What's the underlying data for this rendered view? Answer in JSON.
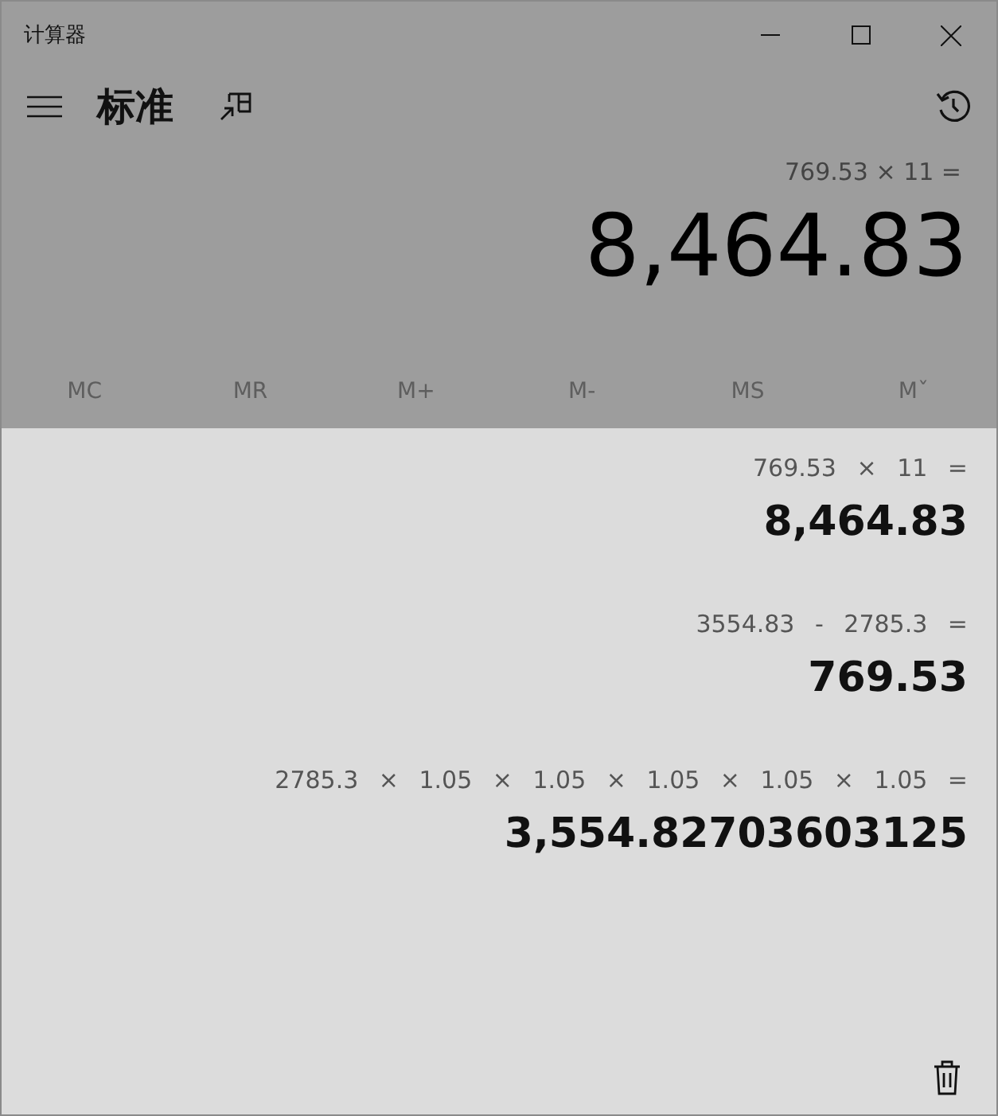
{
  "window": {
    "title": "计算器"
  },
  "header": {
    "mode": "标准"
  },
  "display": {
    "expression": "769.53 × 11 =",
    "result": "8,464.83"
  },
  "memory_buttons": [
    {
      "label": "MC",
      "disabled": true
    },
    {
      "label": "MR",
      "disabled": true
    },
    {
      "label": "M+",
      "disabled": true
    },
    {
      "label": "M-",
      "disabled": true
    },
    {
      "label": "MS",
      "disabled": true
    },
    {
      "label": "Mˇ",
      "disabled": true
    }
  ],
  "history": [
    {
      "expression": "769.53 × 11 =",
      "result": "8,464.83"
    },
    {
      "expression": "3554.83 - 2785.3 =",
      "result": "769.53"
    },
    {
      "expression": "2785.3 × 1.05 × 1.05 × 1.05 × 1.05 × 1.05 =",
      "result": "3,554.82703603125"
    }
  ]
}
